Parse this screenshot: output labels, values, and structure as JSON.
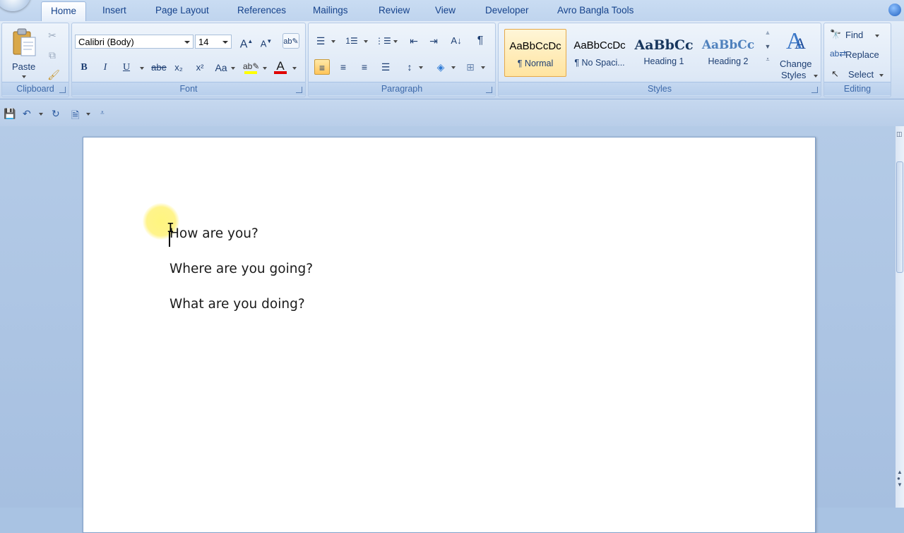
{
  "tabs": [
    {
      "label": "Home",
      "active": true
    },
    {
      "label": "Insert"
    },
    {
      "label": "Page Layout"
    },
    {
      "label": "References"
    },
    {
      "label": "Mailings"
    },
    {
      "label": "Review"
    },
    {
      "label": "View"
    },
    {
      "label": "Developer"
    },
    {
      "label": "Avro Bangla Tools"
    }
  ],
  "clipboard": {
    "paste_label": "Paste",
    "group_label": "Clipboard"
  },
  "font": {
    "font_name": "Calibri (Body)",
    "font_size": "14",
    "group_label": "Font",
    "bold": "B",
    "italic": "I",
    "underline": "U",
    "strike": "abe",
    "subscript": "x₂",
    "superscript": "x²",
    "change_case": "Aa",
    "grow": "A",
    "shrink": "A",
    "font_color": "A",
    "font_color_hex": "#e00000",
    "highlight_hex": "#ffff00"
  },
  "paragraph": {
    "group_label": "Paragraph",
    "pilcrow": "¶"
  },
  "styles": {
    "group_label": "Styles",
    "items": [
      {
        "sample": "AaBbCcDc",
        "name": "¶ Normal",
        "selected": true
      },
      {
        "sample": "AaBbCcDc",
        "name": "¶ No Spaci..."
      },
      {
        "sample": "AaBbCc",
        "name": "Heading 1"
      },
      {
        "sample": "AaBbCc",
        "name": "Heading 2"
      }
    ],
    "change_styles_line1": "Change",
    "change_styles_line2": "Styles"
  },
  "editing": {
    "group_label": "Editing",
    "find": "Find",
    "replace": "Replace",
    "select": "Select"
  },
  "document": {
    "lines": [
      "How are you?",
      "Where are you going?",
      "What are you doing?"
    ]
  },
  "colors": {
    "accent": "#15428b",
    "selected_style": "#ffe4a0"
  }
}
